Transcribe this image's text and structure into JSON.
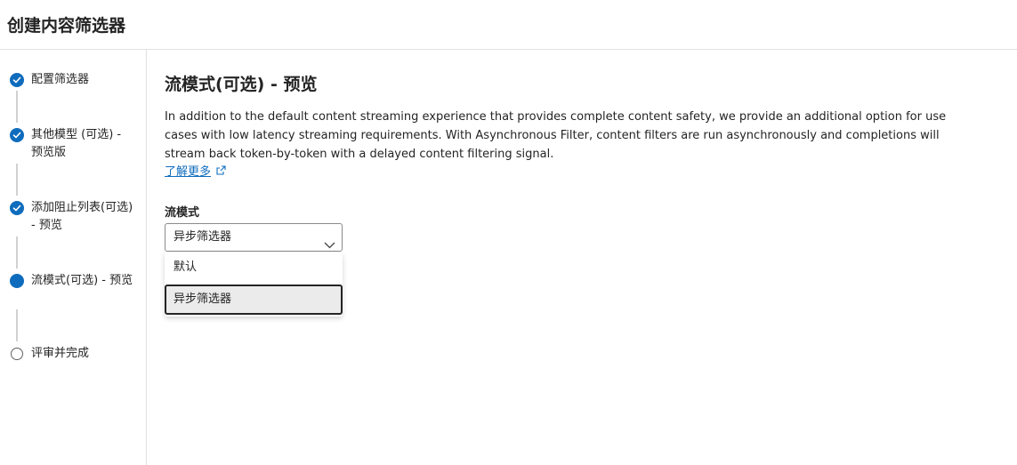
{
  "header": {
    "title": "创建内容筛选器"
  },
  "steps": [
    {
      "label": "配置筛选器",
      "state": "done"
    },
    {
      "label": "其他模型 (可选) - 预览版",
      "state": "done"
    },
    {
      "label": "添加阻止列表(可选) - 预览",
      "state": "done"
    },
    {
      "label": "流模式(可选) - 预览",
      "state": "current"
    },
    {
      "label": "评审并完成",
      "state": "todo"
    }
  ],
  "main": {
    "title": "流模式(可选) - 预览",
    "description": "In addition to the default content streaming experience that provides complete content safety, we provide an additional option for use cases with low latency streaming requirements. With Asynchronous Filter, content filters are run asynchronously and completions will stream back token-by-token with a delayed content filtering signal.",
    "learn_more": "了解更多",
    "field_label": "流模式",
    "select_value": "异步筛选器",
    "options": [
      "默认",
      "异步筛选器"
    ]
  },
  "colors": {
    "accent": "#0f6cbd",
    "text": "#242424",
    "border": "#e1e1e1"
  }
}
